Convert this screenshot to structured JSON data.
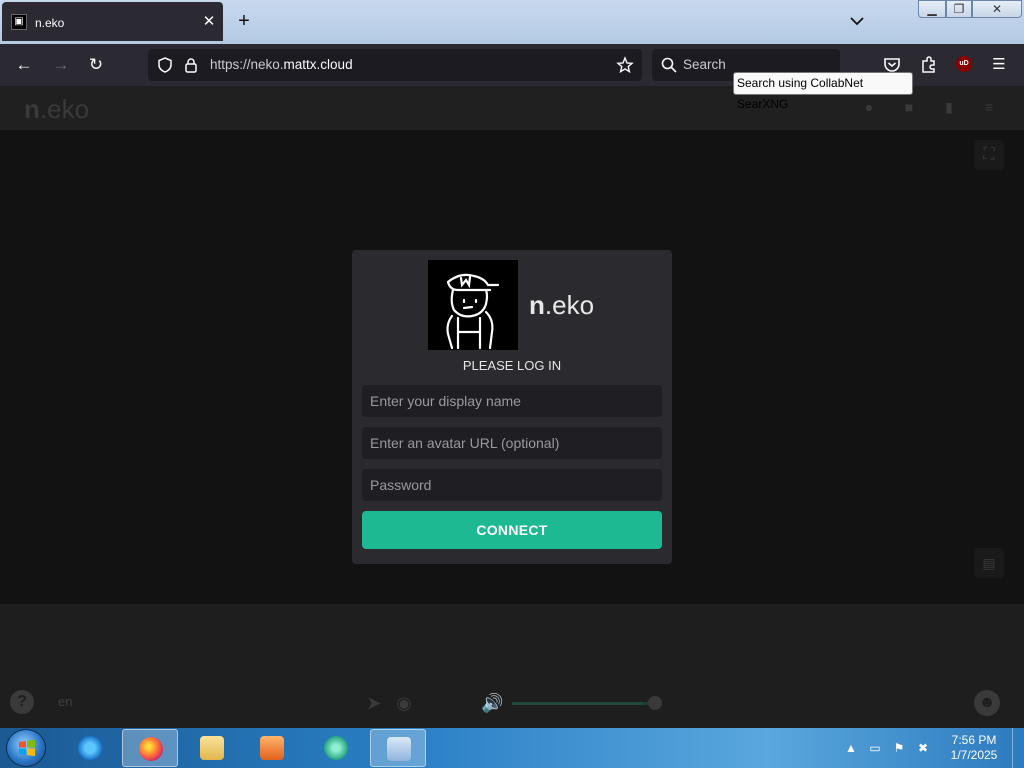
{
  "browser": {
    "tab_title": "n.eko",
    "tab_favicon_icon": "robot-icon",
    "tab_close": "✕",
    "new_tab": "+",
    "url_prefix": "https://neko.",
    "url_domain": "mattx.cloud",
    "search_placeholder": "Search",
    "tooltip": "Search using CollabNet SearXNG",
    "ublock_label": "uD"
  },
  "app": {
    "brand_bold": "n",
    "brand_rest": ".eko",
    "language": "en"
  },
  "login": {
    "logo_title_bold": "n",
    "logo_title_rest": ".eko",
    "prompt": "PLEASE LOG IN",
    "display_name_placeholder": "Enter your display name",
    "avatar_placeholder": "Enter an avatar URL (optional)",
    "password_placeholder": "Password",
    "connect_label": "CONNECT"
  },
  "player": {
    "volume_level": 0.92
  },
  "taskbar": {
    "time": "7:56 PM",
    "date": "1/7/2025",
    "colors": {
      "accent": "#1db992"
    }
  }
}
